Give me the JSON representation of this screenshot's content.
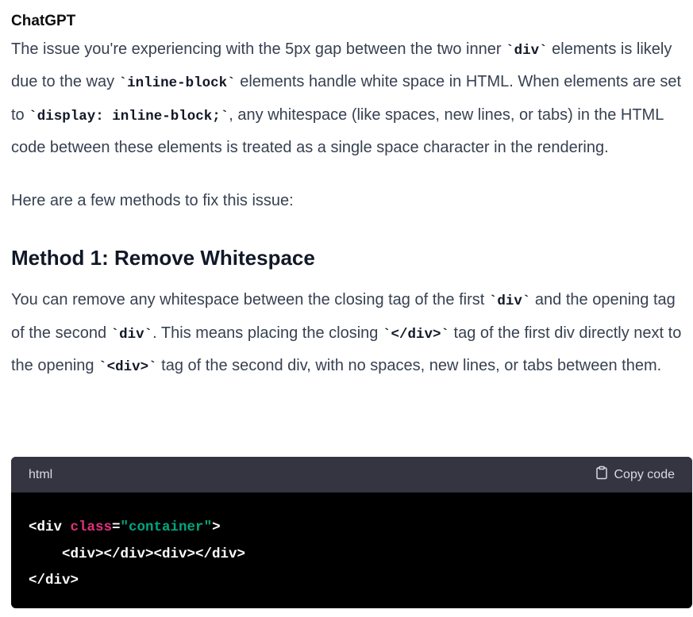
{
  "message": {
    "author": "ChatGPT",
    "paragraph1": [
      "The issue you're experiencing with the 5px gap between the two inner ",
      "`div`",
      " elements is likely due to the way ",
      "`inline-block`",
      " elements handle white space in HTML. When elements are set to ",
      "`display: inline-block;`",
      ", any whitespace (like spaces, new lines, or tabs) in the HTML code between these elements is treated as a single space character in the rendering."
    ],
    "paragraph2": "Here are a few methods to fix this issue:",
    "heading": "Method 1: Remove Whitespace",
    "paragraph3": [
      "You can remove any whitespace between the closing tag of the first ",
      "`div`",
      " and the opening tag of the second ",
      "`div`",
      ". This means placing the closing ",
      "`</div>`",
      " tag of the first div directly next to the opening ",
      "`<div>`",
      " tag of the second div, with no spaces, new lines, or tabs between them."
    ]
  },
  "code_block": {
    "language": "html",
    "copy_label": "Copy code",
    "copy_icon": "clipboard-icon",
    "line1": {
      "open": "<div ",
      "attr": "class",
      "eq": "=",
      "value": "\"container\"",
      "close": ">"
    },
    "line2": "    <div></div><div></div>",
    "line3": "</div>",
    "colors": {
      "header_bg": "#343541",
      "body_bg": "#000000",
      "attribute": "#df3079",
      "string": "#00a67d"
    }
  }
}
